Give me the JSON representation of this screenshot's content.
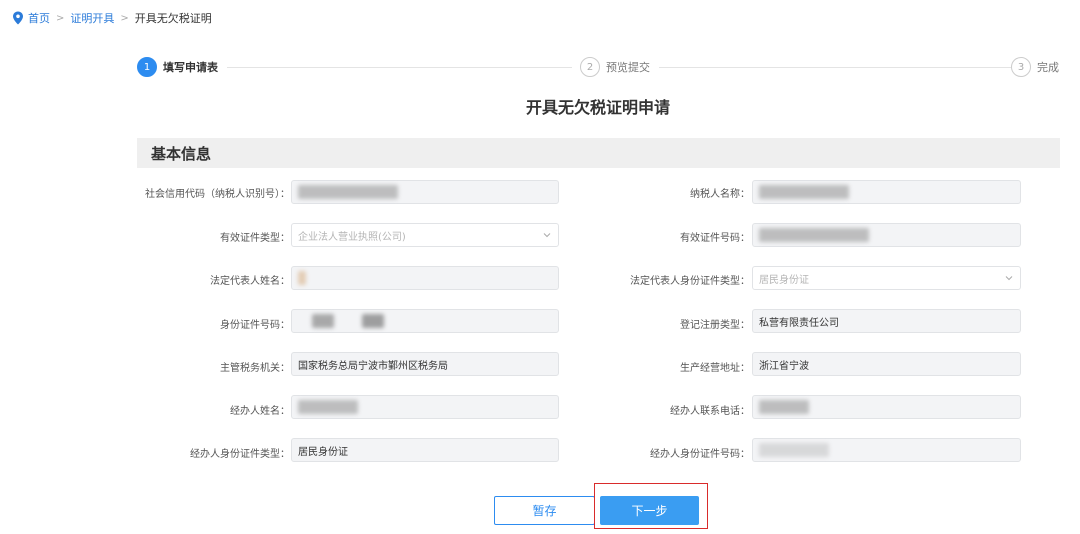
{
  "breadcrumb": {
    "home": "首页",
    "section": "证明开具",
    "current": "开具无欠税证明",
    "separator": ">"
  },
  "steps": [
    {
      "number": "1",
      "label": "填写申请表"
    },
    {
      "number": "2",
      "label": "预览提交"
    },
    {
      "number": "3",
      "label": "完成"
    }
  ],
  "title": "开具无欠税证明申请",
  "section": "基本信息",
  "fields": {
    "credit_code": {
      "label": "社会信用代码（纳税人识别号）：",
      "value": ""
    },
    "taxpayer_name": {
      "label": "纳税人名称：",
      "value": ""
    },
    "id_type": {
      "label": "有效证件类型：",
      "value": "企业法人营业执照(公司)"
    },
    "id_number": {
      "label": "有效证件号码：",
      "value": ""
    },
    "legal_rep_name": {
      "label": "法定代表人姓名：",
      "value": ""
    },
    "legal_rep_id_type": {
      "label": "法定代表人身份证件类型：",
      "value": "居民身份证"
    },
    "id_card_number": {
      "label": "身份证件号码：",
      "value": ""
    },
    "registration_type": {
      "label": "登记注册类型：",
      "value": "私营有限责任公司"
    },
    "tax_authority": {
      "label": "主管税务机关：",
      "value": "国家税务总局宁波市鄞州区税务局"
    },
    "business_address": {
      "label": "生产经营地址：",
      "value": "浙江省宁波"
    },
    "agent_name": {
      "label": "经办人姓名：",
      "value": ""
    },
    "agent_phone": {
      "label": "经办人联系电话：",
      "value": ""
    },
    "agent_id_type": {
      "label": "经办人身份证件类型：",
      "value": "居民身份证"
    },
    "agent_id_number": {
      "label": "经办人身份证件号码：",
      "value": ""
    }
  },
  "buttons": {
    "save": "暂存",
    "next": "下一步"
  },
  "colors": {
    "primary": "#2d8cf0",
    "highlight": "#d92b2b"
  }
}
